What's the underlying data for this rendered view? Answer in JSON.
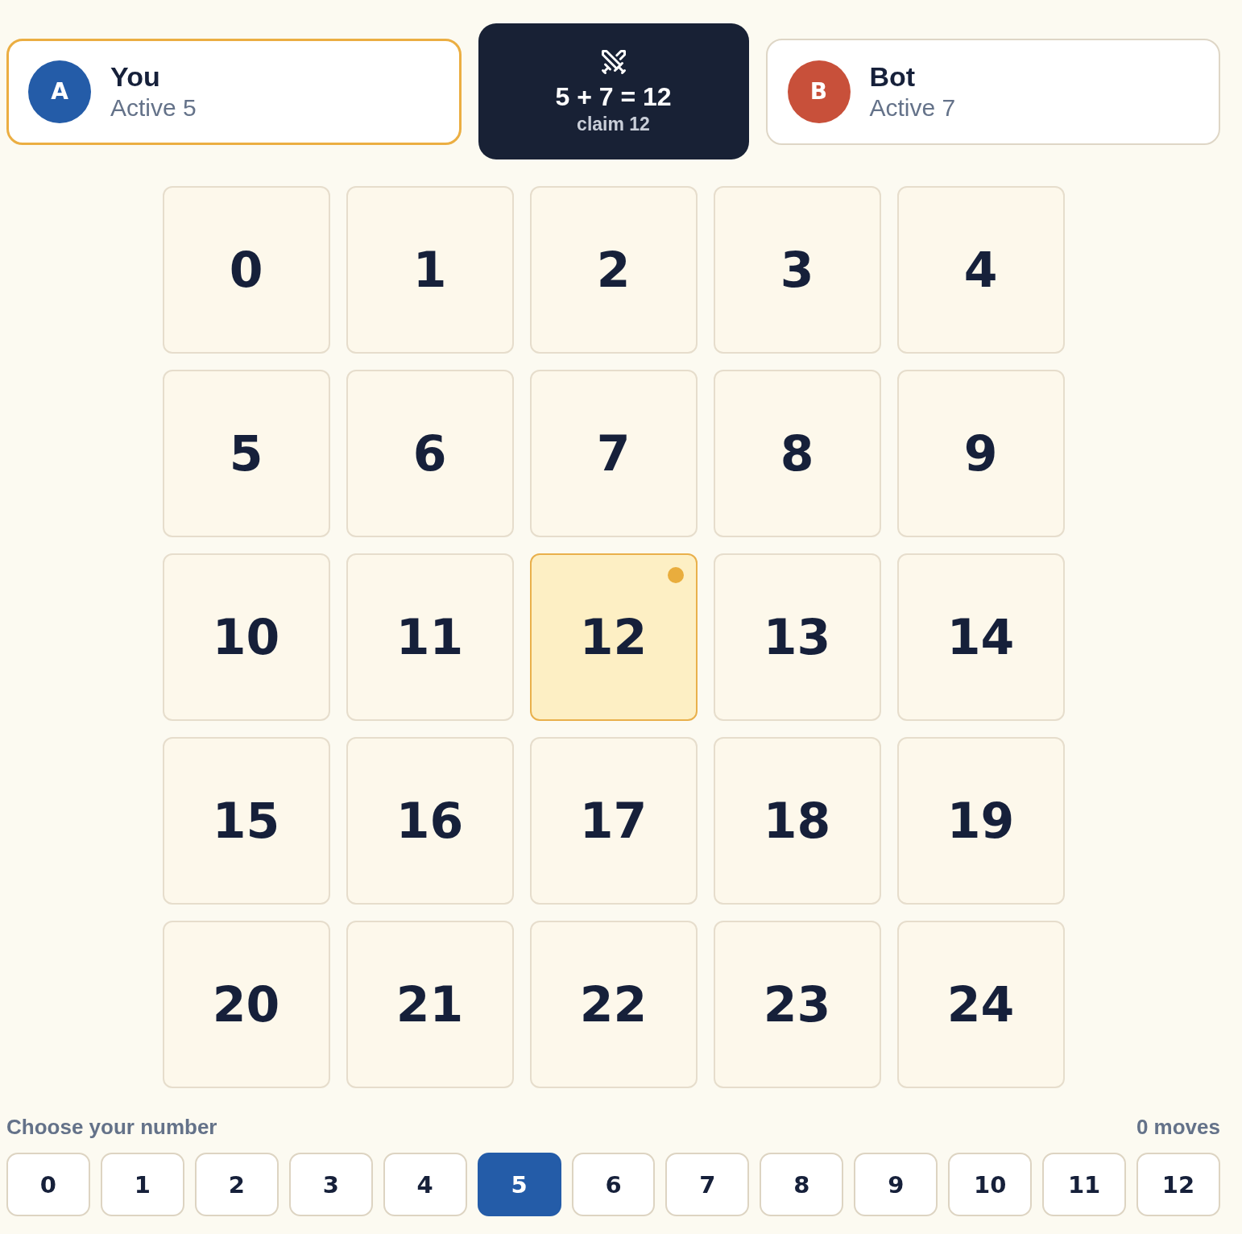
{
  "players": [
    {
      "avatar": "A",
      "name": "You",
      "status": "Active 5",
      "color": "#245ca8",
      "selected": true
    },
    {
      "avatar": "B",
      "name": "Bot",
      "status": "Active 7",
      "color": "#c8503a",
      "selected": false
    }
  ],
  "round": {
    "equation": "5 + 7 = 12",
    "claim": "claim 12"
  },
  "board": {
    "tiles": [
      {
        "label": "0",
        "selected": false
      },
      {
        "label": "1",
        "selected": false
      },
      {
        "label": "2",
        "selected": false
      },
      {
        "label": "3",
        "selected": false
      },
      {
        "label": "4",
        "selected": false
      },
      {
        "label": "5",
        "selected": false
      },
      {
        "label": "6",
        "selected": false
      },
      {
        "label": "7",
        "selected": false
      },
      {
        "label": "8",
        "selected": false
      },
      {
        "label": "9",
        "selected": false
      },
      {
        "label": "10",
        "selected": false
      },
      {
        "label": "11",
        "selected": false
      },
      {
        "label": "12",
        "selected": true
      },
      {
        "label": "13",
        "selected": false
      },
      {
        "label": "14",
        "selected": false
      },
      {
        "label": "15",
        "selected": false
      },
      {
        "label": "16",
        "selected": false
      },
      {
        "label": "17",
        "selected": false
      },
      {
        "label": "18",
        "selected": false
      },
      {
        "label": "19",
        "selected": false
      },
      {
        "label": "20",
        "selected": false
      },
      {
        "label": "21",
        "selected": false
      },
      {
        "label": "22",
        "selected": false
      },
      {
        "label": "23",
        "selected": false
      },
      {
        "label": "24",
        "selected": false
      }
    ]
  },
  "picker": {
    "title": "Choose your number",
    "moves": "0 moves",
    "options": [
      {
        "label": "0",
        "selected": false
      },
      {
        "label": "1",
        "selected": false
      },
      {
        "label": "2",
        "selected": false
      },
      {
        "label": "3",
        "selected": false
      },
      {
        "label": "4",
        "selected": false
      },
      {
        "label": "5",
        "selected": true
      },
      {
        "label": "6",
        "selected": false
      },
      {
        "label": "7",
        "selected": false
      },
      {
        "label": "8",
        "selected": false
      },
      {
        "label": "9",
        "selected": false
      },
      {
        "label": "10",
        "selected": false
      },
      {
        "label": "11",
        "selected": false
      },
      {
        "label": "12",
        "selected": false
      }
    ]
  }
}
